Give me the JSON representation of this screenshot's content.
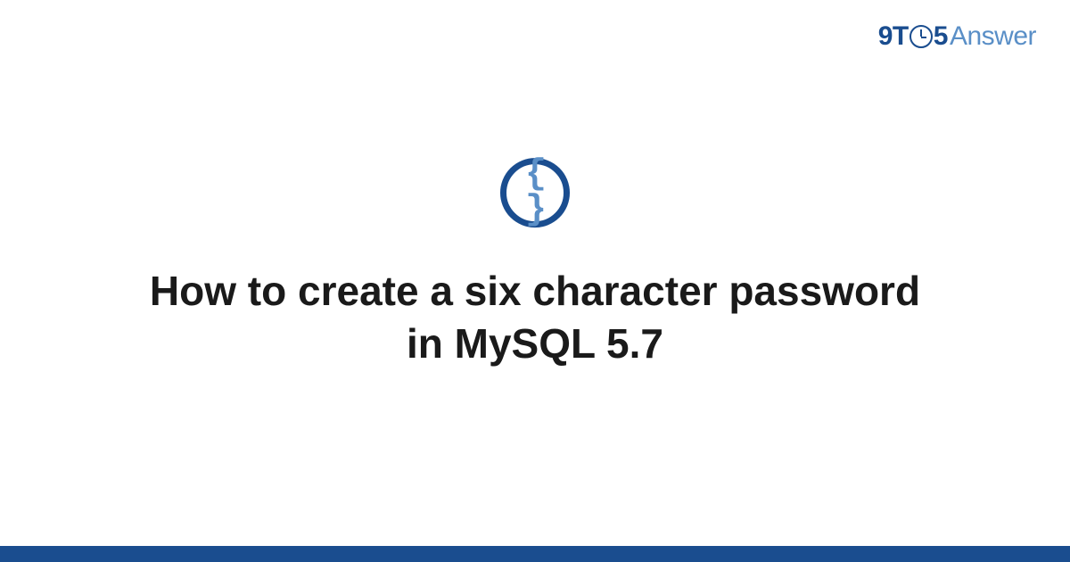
{
  "logo": {
    "prefix": "9T",
    "middle": "5",
    "suffix": "Answer"
  },
  "icon": {
    "braces": "{ }"
  },
  "title": "How to create a six character password in MySQL 5.7",
  "colors": {
    "primary": "#1a4d8f",
    "secondary": "#5a8fc7",
    "text": "#1a1a1a"
  }
}
